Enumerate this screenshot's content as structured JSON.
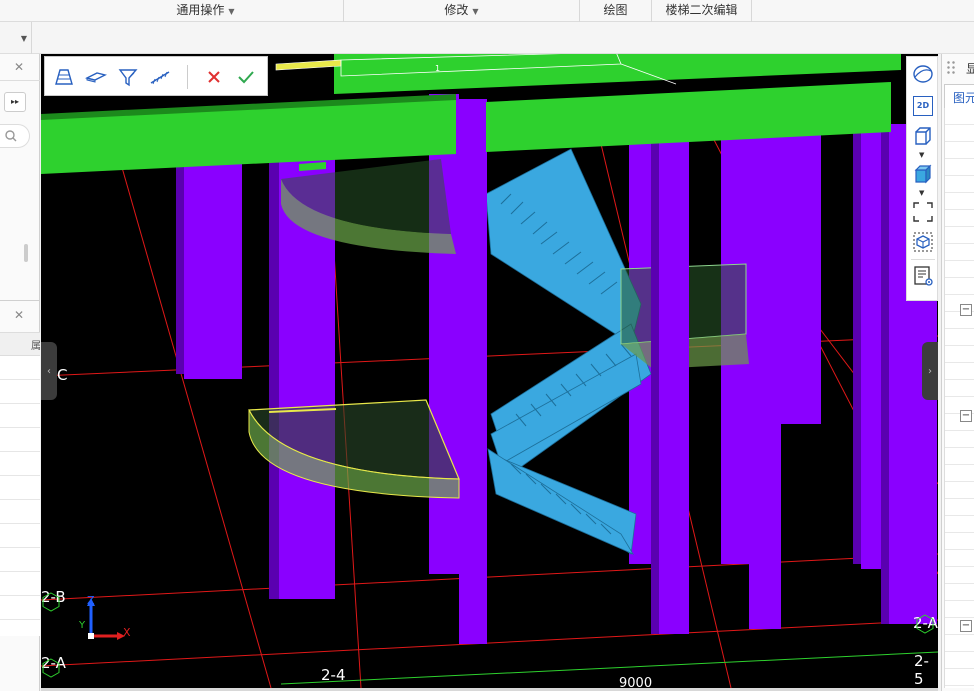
{
  "ribbon": {
    "groups": [
      {
        "label": "通用操作",
        "has_dropdown": true
      },
      {
        "label": "修改",
        "has_dropdown": true
      },
      {
        "label": "绘图",
        "has_dropdown": false
      },
      {
        "label": "楼梯二次编辑",
        "has_dropdown": false
      }
    ]
  },
  "left_panel": {
    "collapse_glyph": "▸▸",
    "close_glyph": "✕",
    "column_header_fragment": "属"
  },
  "right_panel": {
    "tab_fragment": "图元",
    "title_fragment": "显",
    "collapse_glyph": "−"
  },
  "stair_edit_toolbar": {
    "tools": [
      "stair-section-icon",
      "landing-slab-icon",
      "funnel-filter-icon",
      "stair-railing-icon"
    ],
    "cancel_color": "#e03030",
    "confirm_color": "#2fa84f"
  },
  "view_tools": {
    "items": [
      "rotate-orbit-icon",
      "2d-view-icon",
      "3d-box-icon",
      "3d-box-color-icon",
      "zoom-extents-icon",
      "view-cube-icon",
      "layer-display-icon"
    ],
    "two_d_label": "2D"
  },
  "viewport": {
    "axis_labels": {
      "row_c": "C",
      "row_2b": "2-B",
      "row_2a_left": "2-A",
      "row_2a_right": "2-A",
      "col_2_4": "2-4",
      "col_2_5": "2-5",
      "bottom_dimension": "9000",
      "top_dimension": "1"
    },
    "gizmo": {
      "z": "Z",
      "x": "X",
      "y": "Y"
    },
    "colors": {
      "beam": "#2ed12e",
      "column": "#8a00ff",
      "stair": "#3aa8e0",
      "grid_line": "#e01818",
      "selection": "#e8e84a"
    }
  }
}
